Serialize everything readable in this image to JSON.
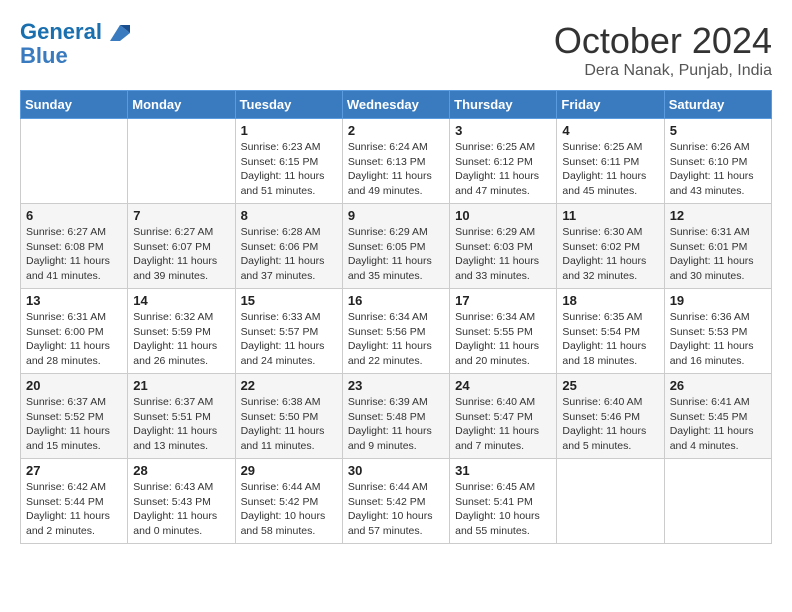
{
  "header": {
    "logo_line1": "General",
    "logo_line2": "Blue",
    "month_title": "October 2024",
    "location": "Dera Nanak, Punjab, India"
  },
  "days_of_week": [
    "Sunday",
    "Monday",
    "Tuesday",
    "Wednesday",
    "Thursday",
    "Friday",
    "Saturday"
  ],
  "weeks": [
    [
      {
        "day": "",
        "info": ""
      },
      {
        "day": "",
        "info": ""
      },
      {
        "day": "1",
        "info": "Sunrise: 6:23 AM\nSunset: 6:15 PM\nDaylight: 11 hours and 51 minutes."
      },
      {
        "day": "2",
        "info": "Sunrise: 6:24 AM\nSunset: 6:13 PM\nDaylight: 11 hours and 49 minutes."
      },
      {
        "day": "3",
        "info": "Sunrise: 6:25 AM\nSunset: 6:12 PM\nDaylight: 11 hours and 47 minutes."
      },
      {
        "day": "4",
        "info": "Sunrise: 6:25 AM\nSunset: 6:11 PM\nDaylight: 11 hours and 45 minutes."
      },
      {
        "day": "5",
        "info": "Sunrise: 6:26 AM\nSunset: 6:10 PM\nDaylight: 11 hours and 43 minutes."
      }
    ],
    [
      {
        "day": "6",
        "info": "Sunrise: 6:27 AM\nSunset: 6:08 PM\nDaylight: 11 hours and 41 minutes."
      },
      {
        "day": "7",
        "info": "Sunrise: 6:27 AM\nSunset: 6:07 PM\nDaylight: 11 hours and 39 minutes."
      },
      {
        "day": "8",
        "info": "Sunrise: 6:28 AM\nSunset: 6:06 PM\nDaylight: 11 hours and 37 minutes."
      },
      {
        "day": "9",
        "info": "Sunrise: 6:29 AM\nSunset: 6:05 PM\nDaylight: 11 hours and 35 minutes."
      },
      {
        "day": "10",
        "info": "Sunrise: 6:29 AM\nSunset: 6:03 PM\nDaylight: 11 hours and 33 minutes."
      },
      {
        "day": "11",
        "info": "Sunrise: 6:30 AM\nSunset: 6:02 PM\nDaylight: 11 hours and 32 minutes."
      },
      {
        "day": "12",
        "info": "Sunrise: 6:31 AM\nSunset: 6:01 PM\nDaylight: 11 hours and 30 minutes."
      }
    ],
    [
      {
        "day": "13",
        "info": "Sunrise: 6:31 AM\nSunset: 6:00 PM\nDaylight: 11 hours and 28 minutes."
      },
      {
        "day": "14",
        "info": "Sunrise: 6:32 AM\nSunset: 5:59 PM\nDaylight: 11 hours and 26 minutes."
      },
      {
        "day": "15",
        "info": "Sunrise: 6:33 AM\nSunset: 5:57 PM\nDaylight: 11 hours and 24 minutes."
      },
      {
        "day": "16",
        "info": "Sunrise: 6:34 AM\nSunset: 5:56 PM\nDaylight: 11 hours and 22 minutes."
      },
      {
        "day": "17",
        "info": "Sunrise: 6:34 AM\nSunset: 5:55 PM\nDaylight: 11 hours and 20 minutes."
      },
      {
        "day": "18",
        "info": "Sunrise: 6:35 AM\nSunset: 5:54 PM\nDaylight: 11 hours and 18 minutes."
      },
      {
        "day": "19",
        "info": "Sunrise: 6:36 AM\nSunset: 5:53 PM\nDaylight: 11 hours and 16 minutes."
      }
    ],
    [
      {
        "day": "20",
        "info": "Sunrise: 6:37 AM\nSunset: 5:52 PM\nDaylight: 11 hours and 15 minutes."
      },
      {
        "day": "21",
        "info": "Sunrise: 6:37 AM\nSunset: 5:51 PM\nDaylight: 11 hours and 13 minutes."
      },
      {
        "day": "22",
        "info": "Sunrise: 6:38 AM\nSunset: 5:50 PM\nDaylight: 11 hours and 11 minutes."
      },
      {
        "day": "23",
        "info": "Sunrise: 6:39 AM\nSunset: 5:48 PM\nDaylight: 11 hours and 9 minutes."
      },
      {
        "day": "24",
        "info": "Sunrise: 6:40 AM\nSunset: 5:47 PM\nDaylight: 11 hours and 7 minutes."
      },
      {
        "day": "25",
        "info": "Sunrise: 6:40 AM\nSunset: 5:46 PM\nDaylight: 11 hours and 5 minutes."
      },
      {
        "day": "26",
        "info": "Sunrise: 6:41 AM\nSunset: 5:45 PM\nDaylight: 11 hours and 4 minutes."
      }
    ],
    [
      {
        "day": "27",
        "info": "Sunrise: 6:42 AM\nSunset: 5:44 PM\nDaylight: 11 hours and 2 minutes."
      },
      {
        "day": "28",
        "info": "Sunrise: 6:43 AM\nSunset: 5:43 PM\nDaylight: 11 hours and 0 minutes."
      },
      {
        "day": "29",
        "info": "Sunrise: 6:44 AM\nSunset: 5:42 PM\nDaylight: 10 hours and 58 minutes."
      },
      {
        "day": "30",
        "info": "Sunrise: 6:44 AM\nSunset: 5:42 PM\nDaylight: 10 hours and 57 minutes."
      },
      {
        "day": "31",
        "info": "Sunrise: 6:45 AM\nSunset: 5:41 PM\nDaylight: 10 hours and 55 minutes."
      },
      {
        "day": "",
        "info": ""
      },
      {
        "day": "",
        "info": ""
      }
    ]
  ]
}
